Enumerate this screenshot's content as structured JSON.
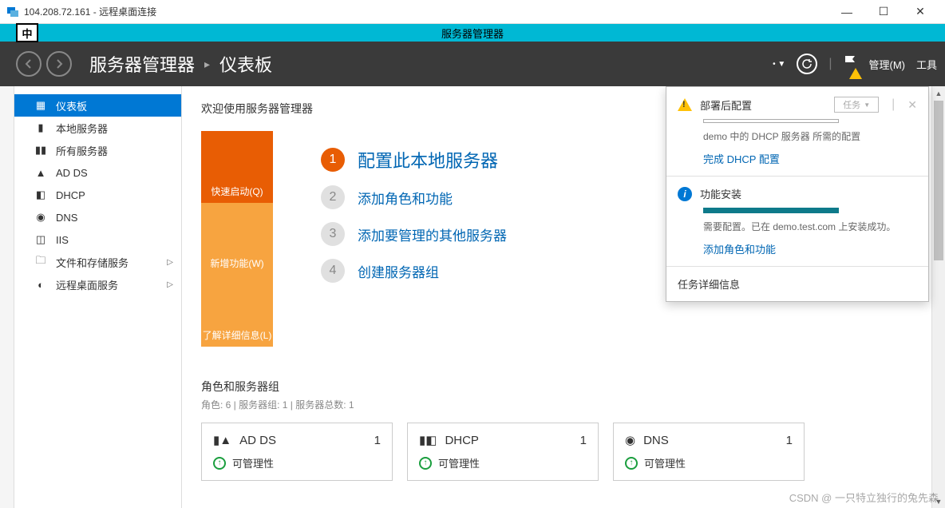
{
  "window": {
    "title": "104.208.72.161 - 远程桌面连接",
    "ime": "中",
    "dragbar": "服务器管理器"
  },
  "header": {
    "crumb1": "服务器管理器",
    "crumb2": "仪表板",
    "manage": "管理(M)",
    "tools": "工具"
  },
  "sidebar": {
    "items": [
      {
        "label": "仪表板"
      },
      {
        "label": "本地服务器"
      },
      {
        "label": "所有服务器"
      },
      {
        "label": "AD DS"
      },
      {
        "label": "DHCP"
      },
      {
        "label": "DNS"
      },
      {
        "label": "IIS"
      },
      {
        "label": "文件和存储服务"
      },
      {
        "label": "远程桌面服务"
      }
    ]
  },
  "main": {
    "welcome": "欢迎使用服务器管理器",
    "tiles": {
      "t1": "快速启动(Q)",
      "t2": "新增功能(W)",
      "t3": "了解详细信息(L)"
    },
    "steps": [
      {
        "num": "1",
        "label": "配置此本地服务器"
      },
      {
        "num": "2",
        "label": "添加角色和功能"
      },
      {
        "num": "3",
        "label": "添加要管理的其他服务器"
      },
      {
        "num": "4",
        "label": "创建服务器组"
      }
    ],
    "groups_title": "角色和服务器组",
    "groups_sub": "角色: 6 | 服务器组: 1 | 服务器总数: 1",
    "groups": [
      {
        "name": "AD DS",
        "count": "1",
        "row": "可管理性"
      },
      {
        "name": "DHCP",
        "count": "1",
        "row": "可管理性"
      },
      {
        "name": "DNS",
        "count": "1",
        "row": "可管理性"
      }
    ]
  },
  "notif": {
    "sec1": {
      "title": "部署后配置",
      "task_btn": "任务",
      "text": "demo 中的 DHCP 服务器 所需的配置",
      "link": "完成 DHCP 配置"
    },
    "sec2": {
      "title": "功能安装",
      "text": "需要配置。已在 demo.test.com 上安装成功。",
      "link": "添加角色和功能"
    },
    "sec3": {
      "link": "任务详细信息"
    }
  },
  "watermark": "CSDN @ 一只特立独行的兔先森"
}
